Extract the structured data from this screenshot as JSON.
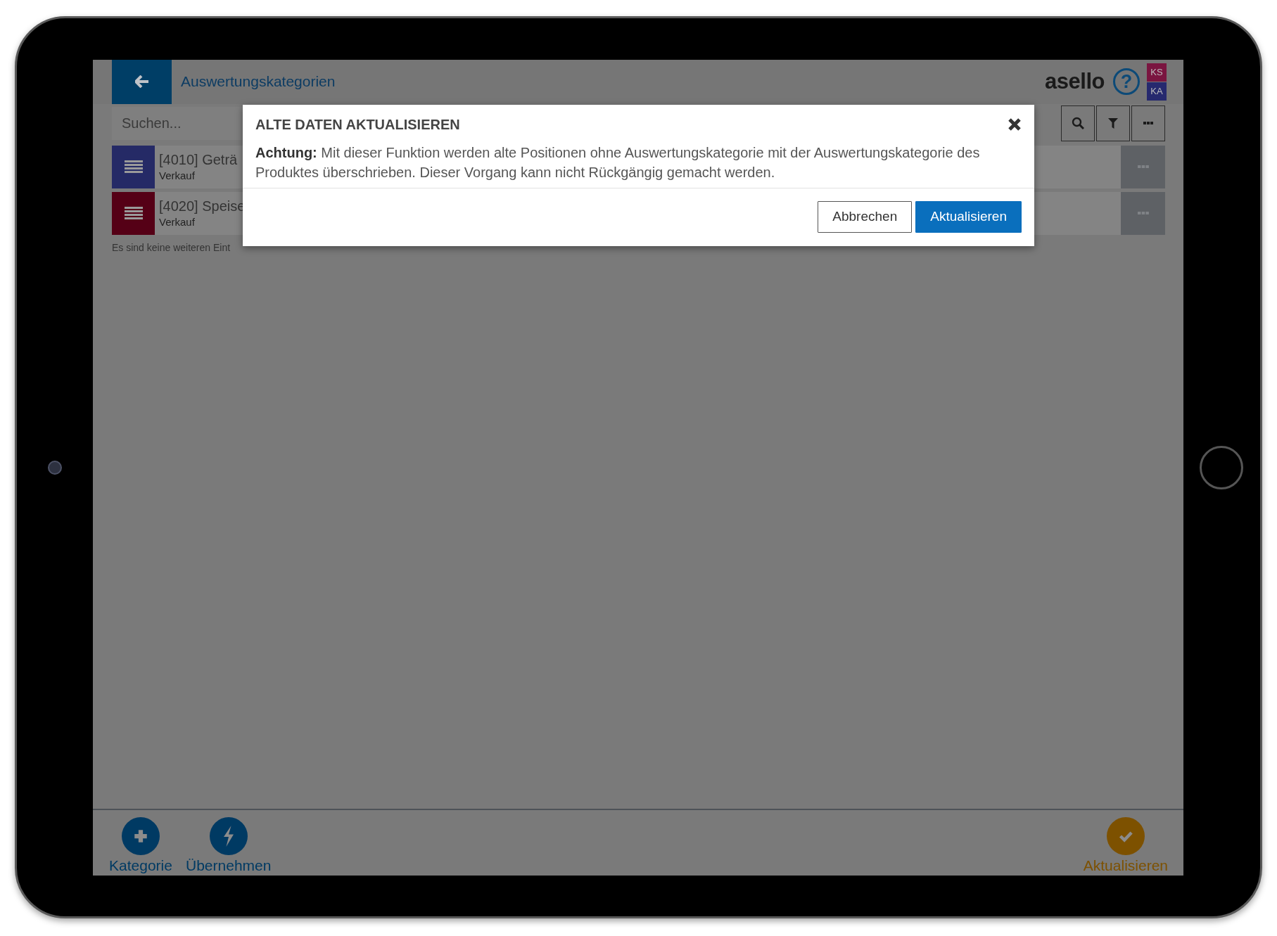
{
  "header": {
    "title": "Auswertungskategorien",
    "logo": "asello",
    "help": "?",
    "user_badges": [
      {
        "label": "KS",
        "color": "#7a1540"
      },
      {
        "label": "KA",
        "color": "#26296e"
      }
    ]
  },
  "search": {
    "placeholder": "Suchen..."
  },
  "list": {
    "items": [
      {
        "title": "[4010] Geträ",
        "subtitle": "Verkauf",
        "color": "#252a66"
      },
      {
        "title": "[4020] Speise",
        "subtitle": "Verkauf",
        "color": "#550016"
      }
    ],
    "end_note": "Es sind keine weiteren Eint"
  },
  "dialog": {
    "title": "ALTE DATEN AKTUALISIEREN",
    "message": "**Achtung:** Mit dieser Funktion werden alte Positionen ohne Auswertungskategorie mit der Auswertungskategorie des Produktes überschrieben. Dieser Vorgang kann nicht Rückgängig gemacht werden.",
    "buttons": [
      {
        "label": "Abbrechen",
        "kind": "secondary"
      },
      {
        "label": "Aktualisieren",
        "kind": "primary"
      }
    ]
  },
  "footer": {
    "actions": [
      {
        "label": "Kategorie",
        "kind": "add",
        "color": "#003a63"
      },
      {
        "label": "Übernehmen",
        "kind": "apply",
        "color": "#003a63"
      },
      {
        "label": "Aktualisieren",
        "kind": "confirm",
        "color": "#7d5100"
      }
    ]
  }
}
